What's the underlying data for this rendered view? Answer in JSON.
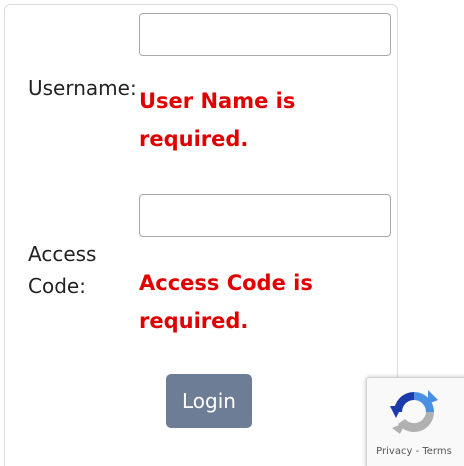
{
  "form": {
    "username_label": "Username:",
    "username_value": "",
    "username_error_line1": "User Name is",
    "username_error_line2": "required.",
    "access_code_label_line1": "Access",
    "access_code_label_line2": "Code:",
    "access_code_value": "",
    "access_code_error_line1": "Access Code is",
    "access_code_error_line2": "required.",
    "login_label": "Login"
  },
  "recaptcha": {
    "privacy_label": "Privacy",
    "separator": " - ",
    "terms_label": "Terms",
    "icon": "recaptcha-logo-icon"
  },
  "colors": {
    "error": "#e00000",
    "button": "#6e7d96",
    "recaptcha_blue": "#4a90e2",
    "recaptcha_dark": "#1c3aa9",
    "recaptcha_gray": "#b1b1b1"
  }
}
